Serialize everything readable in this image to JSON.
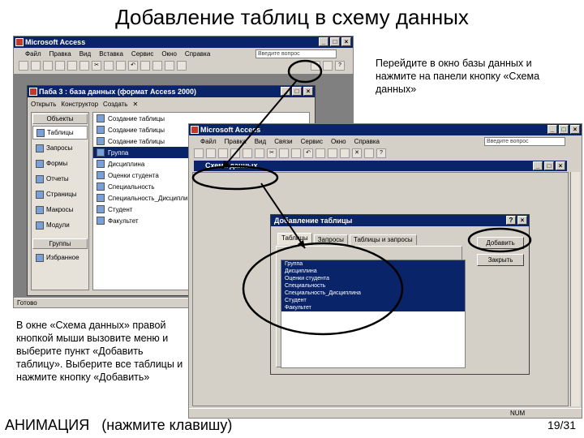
{
  "slide": {
    "title": "Добавление таблиц в схему данных",
    "note_top_right": "Перейдите в окно базы данных и нажмите на панели кнопку «Схема данных»",
    "note_bottom_left": "В окне «Схема данных» правой кнопкой мыши вызовите меню и выберите пункт «Добавить таблицу». Выберите все таблицы и нажмите кнопку «Добавить»",
    "footer_left": "АНИМАЦИЯ   (нажмите клавишу)",
    "page_number": "19/31"
  },
  "access_window_1": {
    "title": "Microsoft Access",
    "menu": [
      "Файл",
      "Правка",
      "Вид",
      "Вставка",
      "Сервис",
      "Окно",
      "Справка"
    ],
    "help_placeholder": "Введите вопрос",
    "status": "Готово",
    "db_window": {
      "title": "Паба 3 : база данных (формат Access 2000)",
      "toolbar": [
        "Открыть",
        "Конструктор",
        "Создать"
      ],
      "objects_header": "Объекты",
      "objects": [
        "Таблицы",
        "Запросы",
        "Формы",
        "Отчеты",
        "Страницы",
        "Макросы",
        "Модули"
      ],
      "groups_header": "Группы",
      "groups": [
        "Избранное"
      ],
      "tables": [
        "Создание таблицы",
        "Создание таблицы",
        "Создание таблицы",
        "Группа",
        "Дисциплина",
        "Оценки студента",
        "Специальность",
        "Специальность_Дисциплина",
        "Студент",
        "Факультет"
      ]
    }
  },
  "access_window_2": {
    "title": "Microsoft Access",
    "menu": [
      "Файл",
      "Правка",
      "Вид",
      "Связи",
      "Сервис",
      "Окно",
      "Справка"
    ],
    "help_placeholder": "Введите вопрос",
    "schema_title": "Схема данных",
    "status": "NUM",
    "dialog": {
      "title": "Добавление таблицы",
      "tabs": [
        "Таблицы",
        "Запросы",
        "Таблицы и запросы"
      ],
      "items": [
        "Группа",
        "Дисциплина",
        "Оценки студента",
        "Специальность",
        "Специальность_Дисциплина",
        "Студент",
        "Факультет"
      ],
      "add_button": "Добавить",
      "close_button": "Закрыть"
    }
  }
}
